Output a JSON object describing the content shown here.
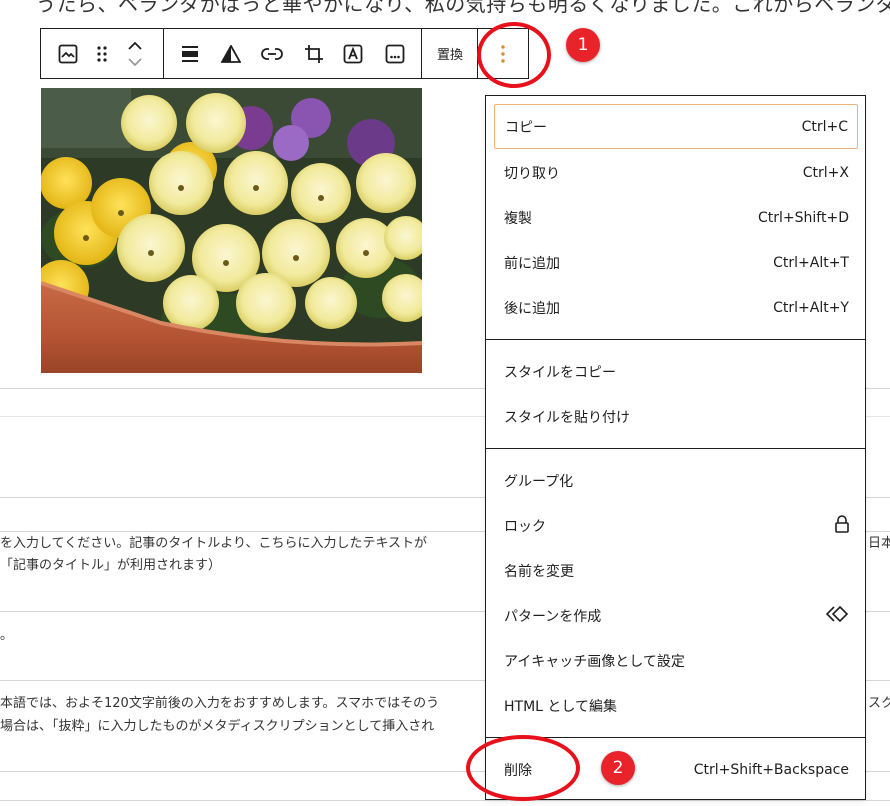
{
  "top_text": "うたら、ベランダがぱっと華やかになり、私の気持ちも明るくなりました。これからベランダ",
  "toolbar": {
    "replace_label": "置換"
  },
  "content": {
    "line1": "を入力してください。記事のタイトルより、こちらに入力したテキストが",
    "line1_right": "日本語",
    "line2": "「記事のタイトル」が利用されます）",
    "line3": "。",
    "line4": "本語では、およそ120文字前後の入力をおすすめします。スマホではそのう",
    "line4_right": "スクリ",
    "line5": "場合は、「抜粋」に入力したものがメタディスクリプションとして挿入され"
  },
  "menu": {
    "group1": [
      {
        "label": "コピー",
        "shortcut": "Ctrl+C"
      },
      {
        "label": "切り取り",
        "shortcut": "Ctrl+X"
      },
      {
        "label": "複製",
        "shortcut": "Ctrl+Shift+D"
      },
      {
        "label": "前に追加",
        "shortcut": "Ctrl+Alt+T"
      },
      {
        "label": "後に追加",
        "shortcut": "Ctrl+Alt+Y"
      }
    ],
    "group2": [
      {
        "label": "スタイルをコピー"
      },
      {
        "label": "スタイルを貼り付け"
      }
    ],
    "group3": [
      {
        "label": "グループ化"
      },
      {
        "label": "ロック"
      },
      {
        "label": "名前を変更"
      },
      {
        "label": "パターンを作成"
      },
      {
        "label": "アイキャッチ画像として設定"
      },
      {
        "label": "HTML として編集"
      }
    ],
    "group4": [
      {
        "label": "削除",
        "shortcut": "Ctrl+Shift+Backspace"
      }
    ]
  },
  "annotations": {
    "badge1": "1",
    "badge2": "2"
  },
  "colors": {
    "annotation_red": "#e8111b",
    "focus_outline": "#f0b27a",
    "kebab_orange": "#e08a2a"
  },
  "icons": {
    "image": "image-icon",
    "drag": "drag-handle-icon",
    "move": "move-up-down-icon",
    "align": "align-icon",
    "duotone": "duotone-filter-icon",
    "link": "link-icon",
    "crop": "crop-icon",
    "text_overlay": "text-overlay-icon",
    "alt_text": "alt-text-icon",
    "options": "kebab-options-icon",
    "lock": "lock-icon",
    "pattern": "pattern-diamond-icon"
  }
}
